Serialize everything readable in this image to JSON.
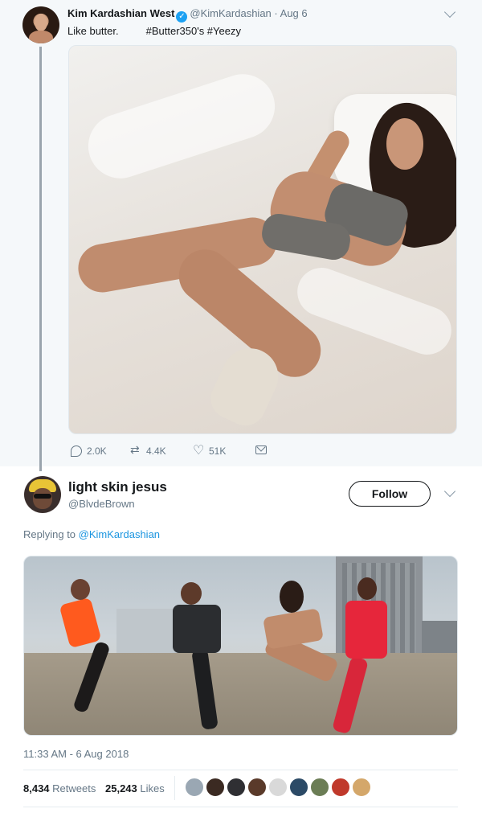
{
  "parent_tweet": {
    "author_name": "Kim Kardashian West",
    "handle": "@KimKardashian",
    "separator": "·",
    "date": "Aug 6",
    "text": "Like butter.",
    "hashtags": "#Butter350's #Yeezy",
    "actions": {
      "replies": "2.0K",
      "retweets": "4.4K",
      "likes": "51K"
    },
    "icons": [
      "verified-badge-icon",
      "reply-icon",
      "retweet-icon",
      "like-icon",
      "message-icon",
      "chevron-down-icon"
    ]
  },
  "main_tweet": {
    "author_name": "light skin jesus",
    "handle": "@BlvdeBrown",
    "follow_label": "Follow",
    "replying_prefix": "Replying to",
    "replying_to": "@KimKardashian",
    "timestamp": "11:33 AM - 6 Aug 2018",
    "retweets_count": "8,434",
    "retweets_label": "Retweets",
    "likes_count": "25,243",
    "likes_label": "Likes",
    "liker_colors": [
      "#9aa7b3",
      "#3b2a22",
      "#2f2f33",
      "#5a3a2a",
      "#d9d9d9",
      "#2c4a66",
      "#6b7d55",
      "#c0392b",
      "#d4a76a"
    ]
  },
  "colors": {
    "link": "#1b95e0",
    "verified": "#1da1f2",
    "muted": "#657786",
    "parent_bg": "#f5f8fa"
  }
}
